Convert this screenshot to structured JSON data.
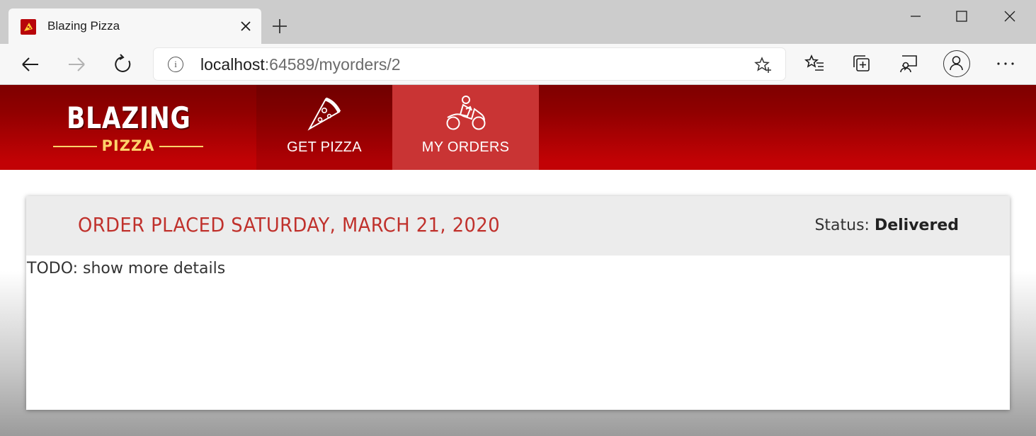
{
  "browser": {
    "tab": {
      "title": "Blazing Pizza",
      "favicon": "pizza-slice-icon"
    },
    "address": {
      "host": "localhost",
      "rest": ":64589/myorders/2"
    },
    "icons": {
      "back": "arrow-left-icon",
      "forward": "arrow-right-icon",
      "reload": "reload-icon",
      "info": "info-icon",
      "favorite": "star-plus-icon",
      "favorites_list": "favorites-icon",
      "collections": "collections-icon",
      "feedback": "feedback-icon",
      "profile": "profile-icon",
      "more": "more-icon",
      "new_tab": "plus-icon",
      "close_tab": "close-icon",
      "minimize": "minimize-icon",
      "maximize": "maximize-icon",
      "close_window": "close-window-icon"
    }
  },
  "site": {
    "logo": {
      "main": "BLAZING",
      "sub": "PIZZA"
    },
    "nav": [
      {
        "label": "GET PIZZA",
        "icon": "pizza-slice-icon",
        "active": false
      },
      {
        "label": "MY ORDERS",
        "icon": "motorbike-icon",
        "active": true
      }
    ],
    "colors": {
      "brand": "#c20205",
      "active_tab": "#c93434",
      "title": "#c0312c"
    }
  },
  "order": {
    "title": "ORDER PLACED SATURDAY, MARCH 21, 2020",
    "status_label": "Status: ",
    "status_value": "Delivered",
    "details": "TODO: show more details"
  }
}
